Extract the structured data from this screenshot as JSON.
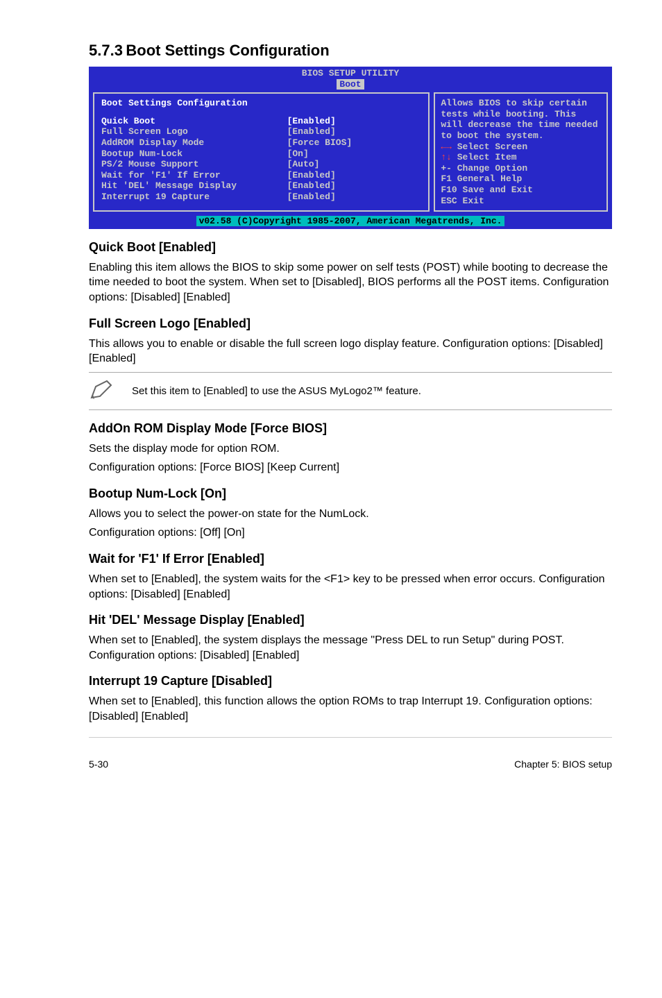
{
  "header": {
    "num": "5.7.3",
    "title": "Boot Settings Configuration"
  },
  "bios": {
    "top": "BIOS SETUP UTILITY",
    "tab": "Boot",
    "panel_title": "Boot Settings Configuration",
    "items": [
      {
        "label": "Quick Boot",
        "value": "[Enabled]",
        "hl": true
      },
      {
        "label": "Full Screen Logo",
        "value": "[Enabled]"
      },
      {
        "label": "AddROM Display Mode",
        "value": "[Force BIOS]"
      },
      {
        "label": "Bootup Num-Lock",
        "value": "[On]"
      },
      {
        "label": "PS/2 Mouse Support",
        "value": "[Auto]"
      },
      {
        "label": "Wait for 'F1' If Error",
        "value": "[Enabled]"
      },
      {
        "label": "Hit 'DEL' Message Display",
        "value": "[Enabled]"
      },
      {
        "label": "Interrupt 19 Capture",
        "value": "[Enabled]"
      }
    ],
    "help_top": "Allows BIOS to skip certain tests while booting. This will decrease the time needed to boot the system.",
    "help_bot": [
      {
        "key": "←→",
        "text": "Select Screen",
        "arrow": true
      },
      {
        "key": "↑↓",
        "text": "Select Item",
        "arrow": true
      },
      {
        "key": "+-",
        "text": "Change Option"
      },
      {
        "key": "F1",
        "text": "General Help"
      },
      {
        "key": "F10",
        "text": "Save and Exit"
      },
      {
        "key": "ESC",
        "text": "Exit"
      }
    ],
    "foot": "v02.58 (C)Copyright 1985-2007, American Megatrends, Inc."
  },
  "sections": [
    {
      "h": "Quick Boot [Enabled]",
      "p": [
        "Enabling this item allows the BIOS to skip some power on self tests (POST) while booting to decrease the time needed to boot the system. When set to [Disabled], BIOS performs all the POST items. Configuration options: [Disabled] [Enabled]"
      ]
    },
    {
      "h": "Full Screen Logo [Enabled]",
      "p": [
        "This allows you to enable or disable the full screen logo display feature. Configuration options: [Disabled] [Enabled]"
      ],
      "note": "Set this item to [Enabled] to use the ASUS MyLogo2™ feature."
    },
    {
      "h": "AddOn ROM Display Mode [Force BIOS]",
      "p": [
        "Sets the display mode for option ROM.",
        "Configuration options: [Force BIOS] [Keep Current]"
      ]
    },
    {
      "h": "Bootup Num-Lock [On]",
      "p": [
        "Allows you to select the power-on state for the NumLock.",
        "Configuration options: [Off] [On]"
      ]
    },
    {
      "h": "Wait for 'F1' If Error [Enabled]",
      "p": [
        "When set to [Enabled], the system waits for the <F1> key to be pressed when error occurs. Configuration options: [Disabled] [Enabled]"
      ]
    },
    {
      "h": "Hit 'DEL' Message Display [Enabled]",
      "p": [
        "When set to [Enabled], the system displays the message \"Press DEL to run Setup\" during POST. Configuration options: [Disabled] [Enabled]"
      ]
    },
    {
      "h": "Interrupt 19 Capture [Disabled]",
      "p": [
        "When set to [Enabled], this function allows the option ROMs to trap Interrupt 19. Configuration options: [Disabled] [Enabled]"
      ]
    }
  ],
  "footer": {
    "left": "5-30",
    "right": "Chapter 5: BIOS setup"
  }
}
